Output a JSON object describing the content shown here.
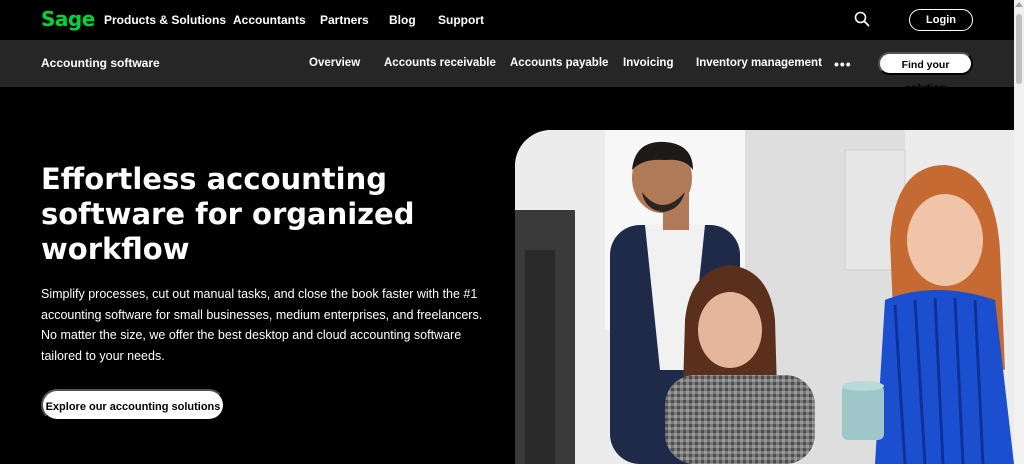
{
  "brand": {
    "logo_text": "Sage",
    "logo_color": "#00d639"
  },
  "topnav": {
    "items": [
      {
        "label": "Products & Solutions"
      },
      {
        "label": "Accountants"
      },
      {
        "label": "Partners"
      },
      {
        "label": "Blog"
      },
      {
        "label": "Support"
      }
    ],
    "search_icon": "search-icon",
    "login_label": "Login"
  },
  "subnav": {
    "title": "Accounting software",
    "items": [
      {
        "label": "Overview"
      },
      {
        "label": "Accounts receivable"
      },
      {
        "label": "Accounts payable"
      },
      {
        "label": "Invoicing"
      },
      {
        "label": "Inventory management"
      }
    ],
    "more_label": "•••",
    "find_label": "Find your solution"
  },
  "hero": {
    "title": "Effortless accounting software for organized workflow",
    "description": "Simplify processes, cut out manual tasks, and close the book faster with the #1 accounting software for small businesses, medium enterprises, and freelancers. No matter the size, we offer the best desktop and cloud accounting software tailored to your needs.",
    "cta_label": "Explore our accounting solutions"
  }
}
